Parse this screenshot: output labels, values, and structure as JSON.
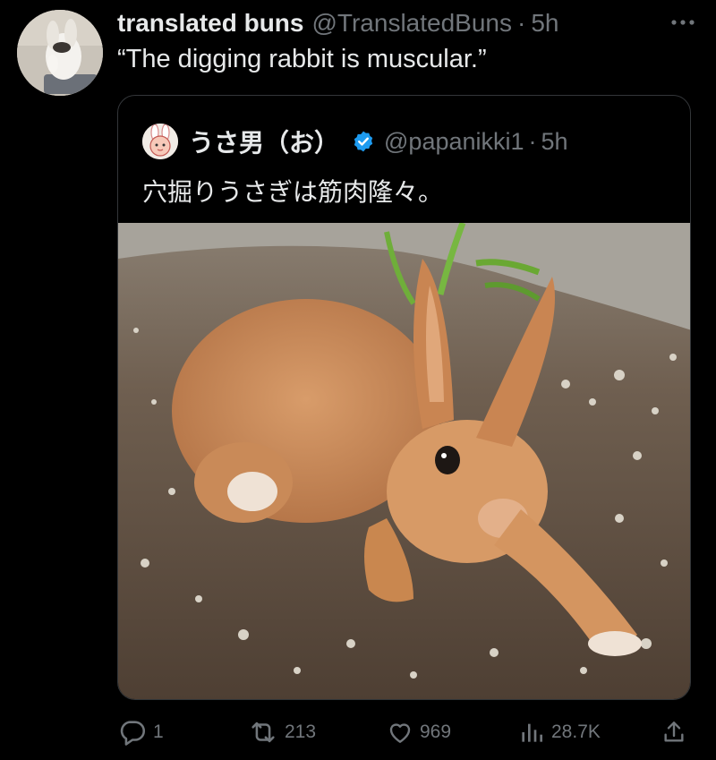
{
  "post": {
    "author_name": "translated buns",
    "author_handle": "@TranslatedBuns",
    "separator": "·",
    "time": "5h",
    "text": "“The digging rabbit is muscular.”",
    "avatar_icon": "bunny-avatar-photo",
    "more_icon": "more-horizontal-icon"
  },
  "quote": {
    "author_name": "うさ男（お）",
    "author_handle": "@papanikki1",
    "separator": "·",
    "time": "5h",
    "text": "穴掘りうさぎは筋肉隆々。",
    "verified_color": "#1d9bf0",
    "verified_icon": "verified-badge-icon",
    "media": "photo of brown rabbit digging in soil"
  },
  "actions": {
    "replies": "1",
    "reposts": "213",
    "likes": "969",
    "views": "28.7K"
  },
  "colors": {
    "background": "#000000",
    "text_primary": "#e7e9ea",
    "text_secondary": "#71767b",
    "border": "#333639"
  }
}
